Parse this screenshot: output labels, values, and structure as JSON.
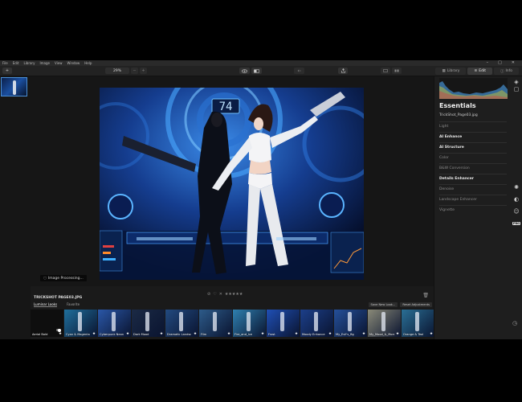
{
  "menu": {
    "items": [
      "File",
      "Edit",
      "Library",
      "Image",
      "View",
      "Window",
      "Help"
    ],
    "window_controls": [
      "–",
      "□",
      "✕"
    ]
  },
  "toolbar": {
    "add_label": "+",
    "zoom_value": "29%",
    "zoom_out_label": "−",
    "zoom_in_label": "+",
    "tabs": [
      {
        "label": "Library",
        "icon": "library-icon"
      },
      {
        "label": "Edit",
        "icon": "sliders-icon"
      },
      {
        "label": "Info",
        "icon": "info-icon"
      }
    ],
    "active_tab": "Edit"
  },
  "canvas": {
    "processing_text": "Image Processing..."
  },
  "panel": {
    "title": "Essentials",
    "filename": "TrickShot_Page03.jpg",
    "sections": [
      {
        "label": "Light",
        "style": "dim"
      },
      {
        "label": "AI Enhance",
        "style": "bright"
      },
      {
        "label": "AI Structure",
        "style": "bright"
      },
      {
        "label": "Color",
        "style": "dim"
      },
      {
        "label": "B&W Conversion",
        "style": "dim"
      },
      {
        "label": "Details Enhancer",
        "style": "bright"
      },
      {
        "label": "Denoise",
        "style": "dim"
      },
      {
        "label": "Landscape Enhancer",
        "style": "dim"
      },
      {
        "label": "Vignette",
        "style": "dim"
      }
    ],
    "pro_badge": "PRO"
  },
  "bottom": {
    "header": "TRICKSHOT PAGE03.JPG",
    "tabs": [
      "Luminar Looks",
      "Favorite"
    ],
    "active_tab": "Luminar Looks",
    "actions": [
      "Save New Look...",
      "Reset Adjustments"
    ],
    "rating_stars": "★★★★★",
    "looks": [
      {
        "label": "Aerial Bold",
        "selected": true,
        "tint": "#101010"
      },
      {
        "label": "Cyan & Magenta",
        "selected": false,
        "tint": "#1f6f9c"
      },
      {
        "label": "Cyberpunk Neon",
        "selected": false,
        "tint": "#2a57a8"
      },
      {
        "label": "Dark Mood",
        "selected": false,
        "tint": "#1b2a45"
      },
      {
        "label": "Dramatic Landsc",
        "selected": false,
        "tint": "#224a80"
      },
      {
        "label": "Film",
        "selected": false,
        "tint": "#2d5b8a"
      },
      {
        "label": "Fire_and_Ice",
        "selected": false,
        "tint": "#2f80b0"
      },
      {
        "label": "Frost",
        "selected": false,
        "tint": "#1f4fb5"
      },
      {
        "label": "Moody Enhance",
        "selected": false,
        "tint": "#1c3f8a"
      },
      {
        "label": "My_Evil's_Bg",
        "selected": false,
        "tint": "#25509a"
      },
      {
        "label": "My_Mood_&_More",
        "selected": false,
        "tint": "#8a8a78"
      },
      {
        "label": "Orange & Teal",
        "selected": false,
        "tint": "#2a6f95"
      }
    ]
  },
  "colors": {
    "accent": "#4a8fd6",
    "background": "#1b1b1b",
    "panel": "#1e1e1e"
  }
}
